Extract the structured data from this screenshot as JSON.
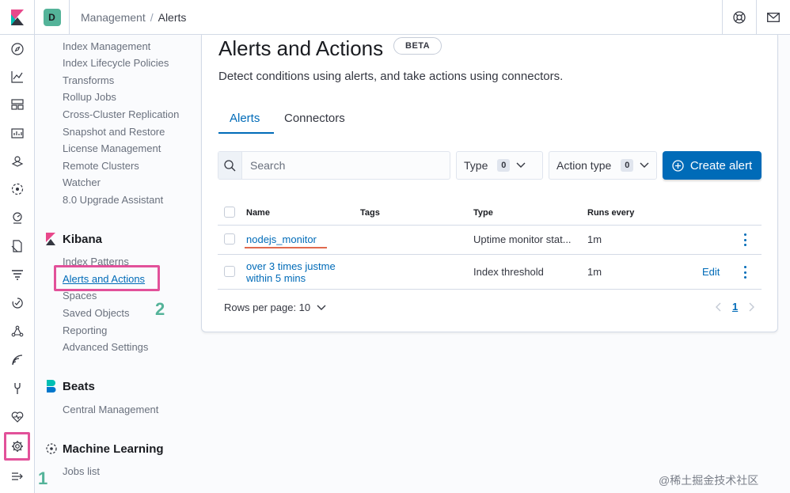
{
  "header": {
    "space_initial": "D",
    "breadcrumbs": [
      "Management",
      "Alerts"
    ],
    "breadcrumb_separator": "/"
  },
  "sidenav": {
    "elasticsearch_items": [
      "Index Management",
      "Index Lifecycle Policies",
      "Transforms",
      "Rollup Jobs",
      "Cross-Cluster Replication",
      "Snapshot and Restore",
      "License Management",
      "Remote Clusters",
      "Watcher",
      "8.0 Upgrade Assistant"
    ],
    "kibana_title": "Kibana",
    "kibana_items": [
      "Index Patterns",
      "Alerts and Actions",
      "Spaces",
      "Saved Objects",
      "Reporting",
      "Advanced Settings"
    ],
    "beats_title": "Beats",
    "beats_items": [
      "Central Management"
    ],
    "ml_title": "Machine Learning",
    "ml_items": [
      "Jobs list"
    ]
  },
  "annotations": {
    "one": "1",
    "two": "2"
  },
  "page": {
    "title": "Alerts and Actions",
    "badge": "BETA",
    "description": "Detect conditions using alerts, and take actions using connectors.",
    "tabs": [
      "Alerts",
      "Connectors"
    ],
    "active_tab": "Alerts"
  },
  "toolbar": {
    "search_placeholder": "Search",
    "type_filter": {
      "label": "Type",
      "count": "0"
    },
    "action_type_filter": {
      "label": "Action type",
      "count": "0"
    },
    "create_button": "Create alert"
  },
  "table": {
    "columns": [
      "Name",
      "Tags",
      "Type",
      "Runs every"
    ],
    "rows": [
      {
        "name": "nodejs_monitor",
        "tags": "",
        "type": "Uptime monitor stat...",
        "runs_every": "1m",
        "action": ""
      },
      {
        "name_line1": "over 3 times justme",
        "name_line2": "within 5 mins",
        "tags": "",
        "type": "Index threshold",
        "runs_every": "1m",
        "action": "Edit"
      }
    ],
    "rows_per_page": "Rows per page: 10",
    "current_page": "1"
  },
  "watermark": "@稀土掘金技术社区",
  "colors": {
    "accent": "#006bb8",
    "highlight": "#e2519a",
    "annotation": "#54b399"
  }
}
